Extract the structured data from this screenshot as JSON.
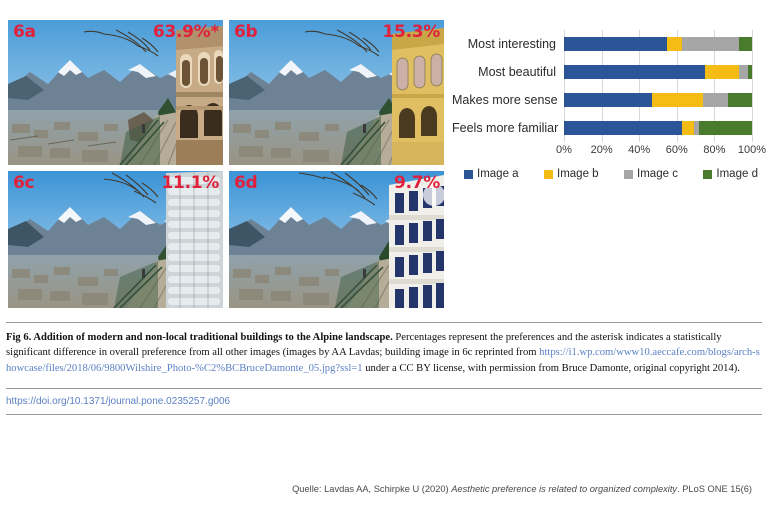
{
  "figure": {
    "panels": [
      {
        "id": "6a",
        "label": "6a",
        "percent": "63.9%*",
        "variant": "traditional-ornate"
      },
      {
        "id": "6b",
        "label": "6b",
        "percent": "15.3%",
        "variant": "yellow-traditional"
      },
      {
        "id": "6c",
        "label": "6c",
        "percent": "11.1%",
        "variant": "modern-glass"
      },
      {
        "id": "6d",
        "label": "6d",
        "percent": "9.7%",
        "variant": "modern-white"
      }
    ],
    "caption": {
      "bold_lead": "Fig 6.  Addition of modern and non-local traditional buildings to the Alpine landscape.",
      "body_part1": " Percentages represent the preferences and the asterisk indicates a statistically significant difference in overall preference from all other images (images by AA Lavdas; building image in 6c reprinted from ",
      "url": "https://i1.wp.com/www10.aeccafe.com/blogs/arch-showcase/files/2018/06/9800Wilshire_Photo-%C2%BCBruceDamonte_05.jpg?ssl=1",
      "body_part2": " under a CC BY license, with permission from Bruce Damonte, original copyright 2014)."
    },
    "doi": "https://doi.org/10.1371/journal.pone.0235257.g006"
  },
  "source": {
    "prefix": "Quelle: Lavdas AA, Schirpke U (2020) ",
    "title": "Aesthetic preference is related to organized complexity",
    "suffix": ". PLoS ONE 15(6)"
  },
  "chart_data": {
    "type": "bar",
    "orientation": "horizontal",
    "stacked": true,
    "stack_mode": "percent",
    "title": "",
    "xlabel": "",
    "ylabel": "",
    "xlim": [
      0,
      100
    ],
    "xticks": [
      0,
      20,
      40,
      60,
      80,
      100
    ],
    "xtick_labels": [
      "0%",
      "20%",
      "40%",
      "60%",
      "80%",
      "100%"
    ],
    "grid": true,
    "legend_position": "bottom",
    "categories": [
      "Most interesting",
      "Most beautiful",
      "Makes more sense",
      "Feels more familiar"
    ],
    "series": [
      {
        "name": "Image a",
        "color": "#2b5597",
        "values": [
          55.0,
          75.0,
          47.0,
          63.0
        ]
      },
      {
        "name": "Image b",
        "color": "#f6bc16",
        "values": [
          8.0,
          18.0,
          27.0,
          6.0
        ]
      },
      {
        "name": "Image c",
        "color": "#a6a6a6",
        "values": [
          30.0,
          5.0,
          13.0,
          3.0
        ]
      },
      {
        "name": "Image d",
        "color": "#4a7a2b",
        "values": [
          7.0,
          2.0,
          13.0,
          28.0
        ]
      }
    ]
  }
}
